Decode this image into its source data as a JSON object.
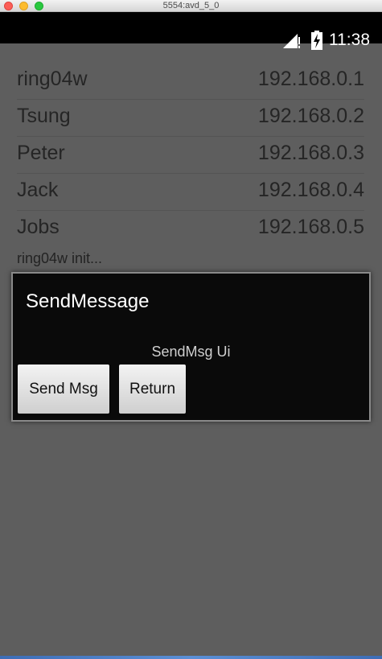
{
  "window": {
    "title": "5554:avd_5_0"
  },
  "status_bar": {
    "time": "11:38",
    "signal_icon": "signal-icon",
    "battery_icon": "battery-charging-icon"
  },
  "list": {
    "rows": [
      {
        "name": "ring04w",
        "ip": "192.168.0.1"
      },
      {
        "name": "Tsung",
        "ip": "192.168.0.2"
      },
      {
        "name": "Peter",
        "ip": "192.168.0.3"
      },
      {
        "name": "Jack",
        "ip": "192.168.0.4"
      },
      {
        "name": "Jobs",
        "ip": "192.168.0.5"
      }
    ],
    "status_text": "ring04w init..."
  },
  "dialog": {
    "title": "SendMessage",
    "message": "SendMsg Ui",
    "send_label": "Send Msg",
    "return_label": "Return"
  },
  "colors": {
    "overlay_bg": "#5e5e5e",
    "dialog_bg": "#0a0a0a",
    "button_bg": "#e6e6e6"
  }
}
